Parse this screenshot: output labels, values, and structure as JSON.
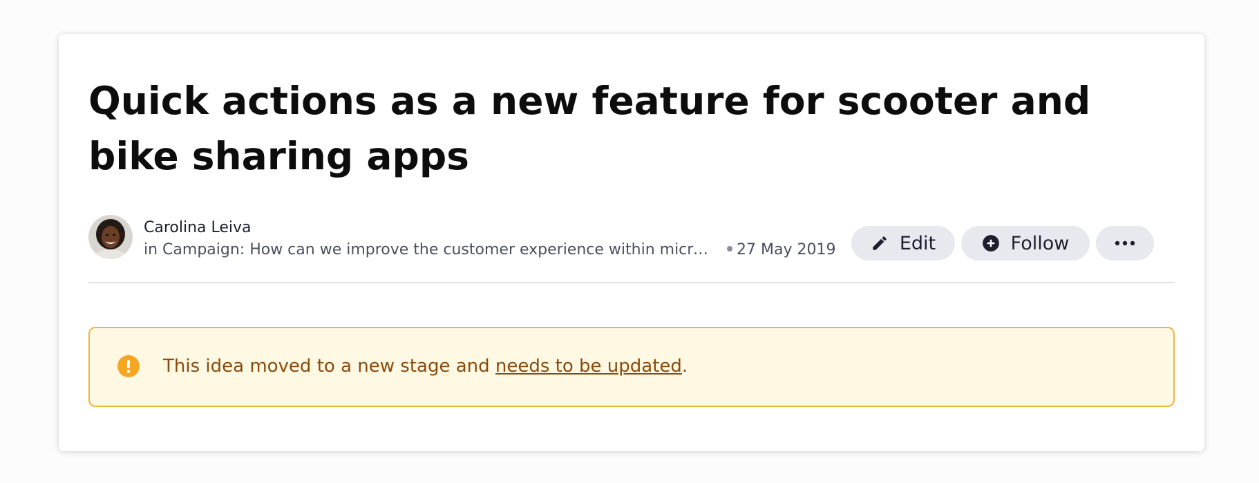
{
  "idea": {
    "title": "Quick actions as a new feature for scooter and bike sharing apps"
  },
  "author": {
    "name": "Carolina Leiva",
    "avatar_icon": "person-avatar"
  },
  "context": {
    "campaign_text": "in Campaign: How can we improve the customer experience within micro-mobility?",
    "date": "27 May 2019"
  },
  "actions": {
    "edit_label": "Edit",
    "edit_icon": "pencil-icon",
    "follow_label": "Follow",
    "follow_icon": "plus-circle-icon",
    "more_icon": "ellipsis-icon"
  },
  "alert": {
    "text_before": "This idea moved to a new stage and ",
    "link_text": "needs to be updated",
    "text_after": ".",
    "icon": "exclamation-circle-icon",
    "colors": {
      "background": "#fff8e3",
      "border": "#f1b53b",
      "text": "#8a4a0b",
      "icon": "#f5a623"
    }
  }
}
